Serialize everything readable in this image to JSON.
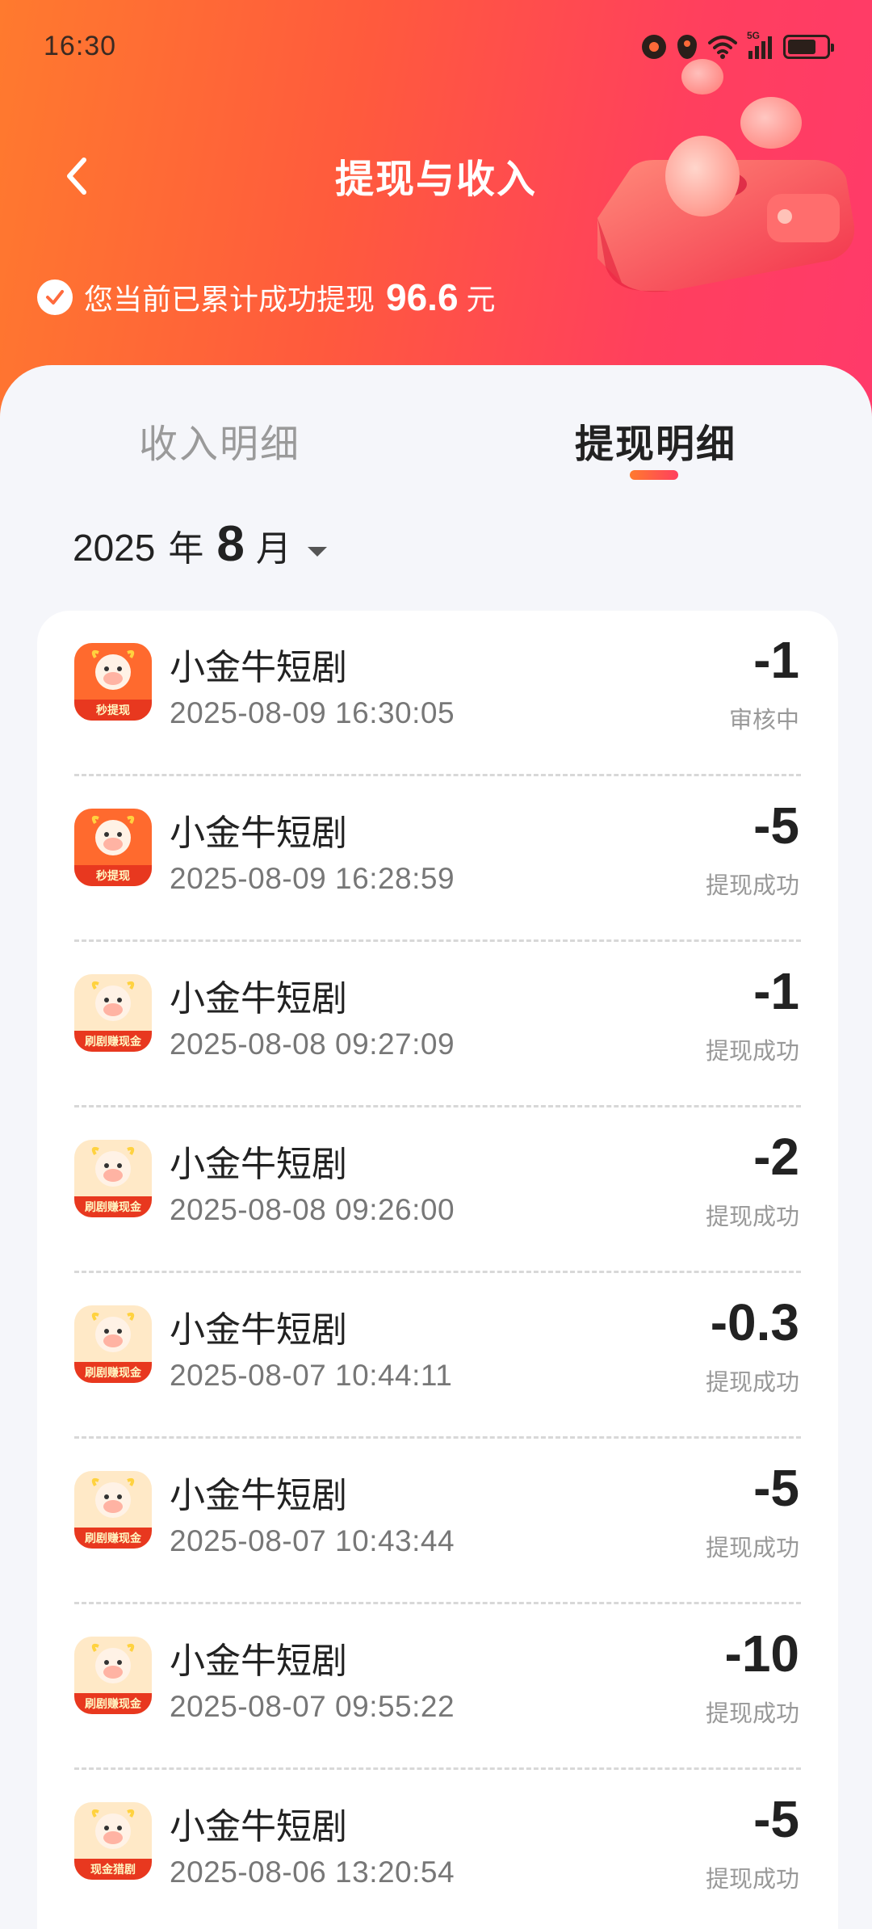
{
  "status_bar": {
    "time": "16:30",
    "network": "5G",
    "icons": [
      "alarm-icon",
      "location-icon",
      "wifi-icon",
      "signal-icon",
      "battery-icon"
    ]
  },
  "header": {
    "title": "提现与收入",
    "summary_prefix": "您当前已累计成功提现",
    "summary_amount": "96.6",
    "summary_unit": "元",
    "colors": {
      "gradient_start": "#ff7a2e",
      "gradient_end": "#ff3a6a"
    }
  },
  "tabs": [
    {
      "label": "收入明细",
      "active": false
    },
    {
      "label": "提现明细",
      "active": true
    }
  ],
  "month_picker": {
    "year": "2025",
    "year_unit": "年",
    "month": "8",
    "month_unit": "月"
  },
  "records": [
    {
      "app": "小金牛短剧",
      "time": "2025-08-09 16:30:05",
      "amount": "-1",
      "status": "审核中",
      "icon_caption": "秒提现"
    },
    {
      "app": "小金牛短剧",
      "time": "2025-08-09 16:28:59",
      "amount": "-5",
      "status": "提现成功",
      "icon_caption": "秒提现"
    },
    {
      "app": "小金牛短剧",
      "time": "2025-08-08 09:27:09",
      "amount": "-1",
      "status": "提现成功",
      "icon_caption": "刷剧赚现金"
    },
    {
      "app": "小金牛短剧",
      "time": "2025-08-08 09:26:00",
      "amount": "-2",
      "status": "提现成功",
      "icon_caption": "刷剧赚现金"
    },
    {
      "app": "小金牛短剧",
      "time": "2025-08-07 10:44:11",
      "amount": "-0.3",
      "status": "提现成功",
      "icon_caption": "刷剧赚现金"
    },
    {
      "app": "小金牛短剧",
      "time": "2025-08-07 10:43:44",
      "amount": "-5",
      "status": "提现成功",
      "icon_caption": "刷剧赚现金"
    },
    {
      "app": "小金牛短剧",
      "time": "2025-08-07 09:55:22",
      "amount": "-10",
      "status": "提现成功",
      "icon_caption": "刷剧赚现金"
    },
    {
      "app": "小金牛短剧",
      "time": "2025-08-06 13:20:54",
      "amount": "-5",
      "status": "提现成功",
      "icon_caption": "现金猎剧"
    }
  ]
}
